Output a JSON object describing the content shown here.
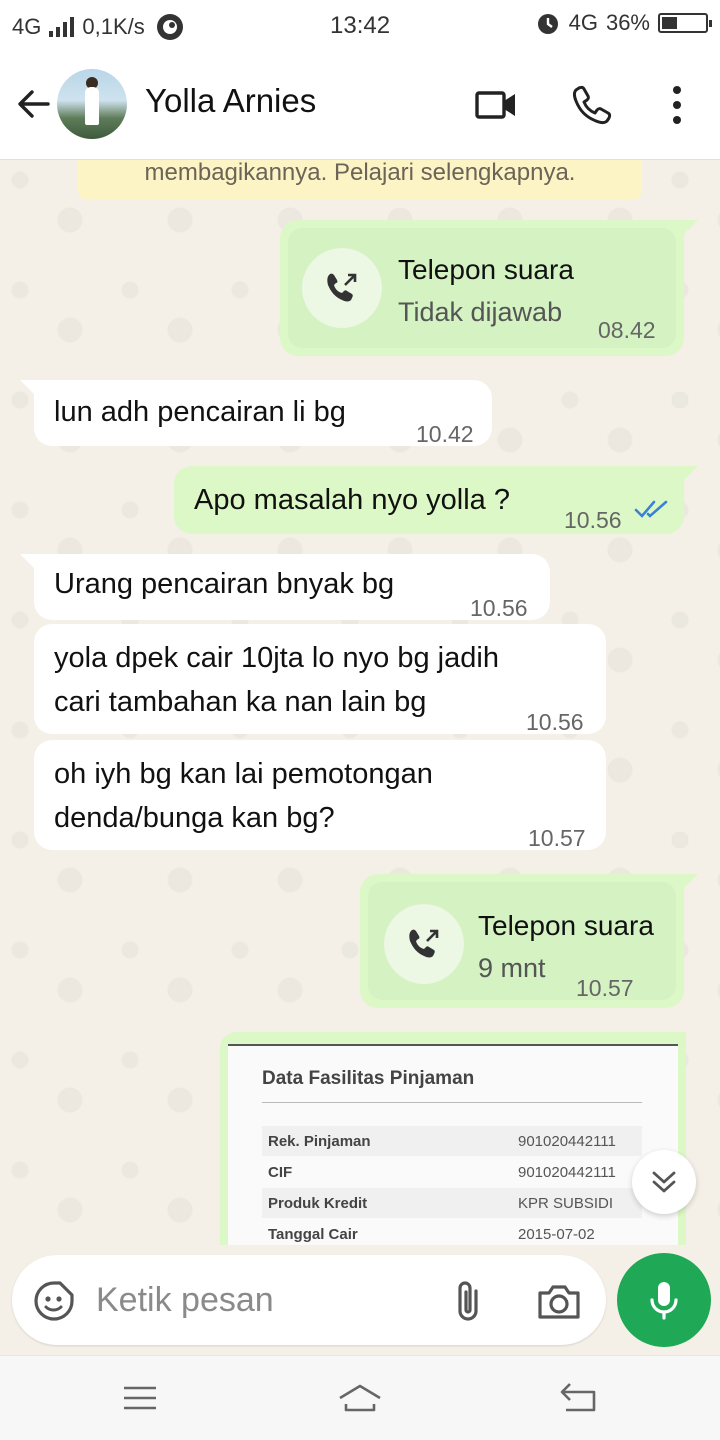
{
  "status_bar": {
    "network": "4G",
    "speed": "0,1K/s",
    "time": "13:42",
    "network_right": "4G",
    "battery": "36%",
    "battery_level_percent": 36
  },
  "header": {
    "contact_name": "Yolla Arnies",
    "icons": [
      "back-arrow-icon",
      "video-call-icon",
      "phone-icon",
      "more-vert-icon"
    ]
  },
  "chat": {
    "encryption_note": "membagikannya. Pelajari selengkapnya.",
    "messages": [
      {
        "type": "call",
        "direction": "out",
        "title": "Telepon suara",
        "subtitle": "Tidak dijawab",
        "time": "08.42"
      },
      {
        "type": "text",
        "direction": "in",
        "text": "lun adh pencairan li bg",
        "time": "10.42"
      },
      {
        "type": "text",
        "direction": "out",
        "text": "Apo masalah nyo yolla ?",
        "time": "10.56",
        "status": "read"
      },
      {
        "type": "text",
        "direction": "in",
        "text": "Urang pencairan bnyak bg",
        "time": "10.56"
      },
      {
        "type": "text",
        "direction": "in",
        "lines": [
          "yola dpek cair 10jta lo nyo bg jadih",
          "cari tambahan ka nan lain bg"
        ],
        "time": "10.56"
      },
      {
        "type": "text",
        "direction": "in",
        "lines": [
          "oh iyh bg kan lai pemotongan",
          "denda/bunga kan bg?"
        ],
        "time": "10.57"
      },
      {
        "type": "call",
        "direction": "out",
        "title": "Telepon suara",
        "subtitle": "9 mnt",
        "time": "10.57"
      },
      {
        "type": "image",
        "direction": "out"
      }
    ],
    "image_doc": {
      "title": "Data Fasilitas Pinjaman",
      "rows": [
        {
          "key": "Rek. Pinjaman",
          "value": "901020442111"
        },
        {
          "key": "CIF",
          "value": "901020442111"
        },
        {
          "key": "Produk Kredit",
          "value": "KPR SUBSIDI"
        },
        {
          "key": "Tanggal Cair",
          "value": "2015-07-02"
        }
      ]
    }
  },
  "input": {
    "placeholder": "Ketik pesan",
    "value": ""
  },
  "colors": {
    "outgoing_bubble": "#dcf8c6",
    "incoming_bubble": "#ffffff",
    "mic_button": "#1fa855",
    "read_ticks": "#3b82d6"
  }
}
